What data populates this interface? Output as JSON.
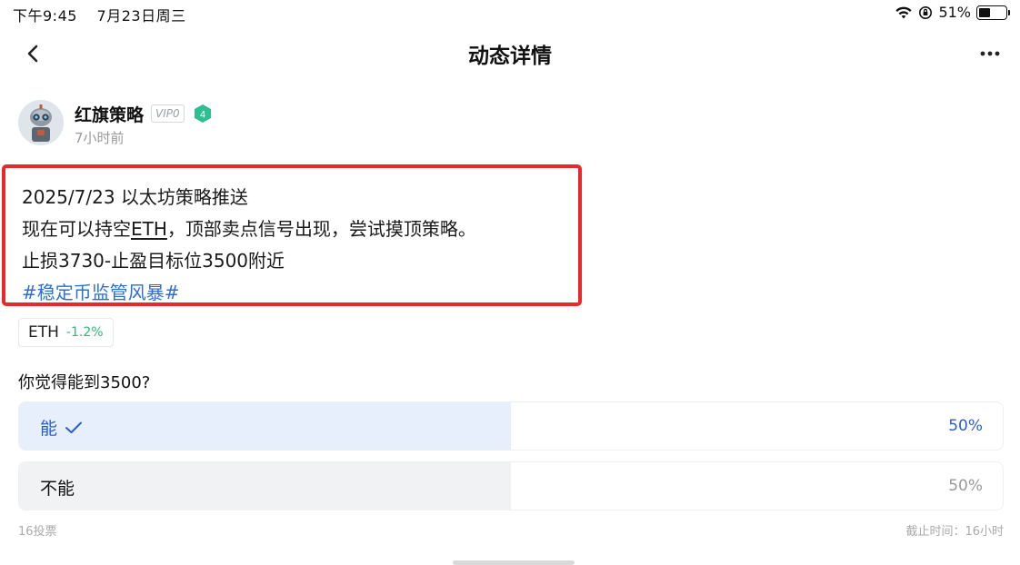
{
  "status_bar": {
    "time": "下午9:45",
    "date": "7月23日周三",
    "battery": "51%",
    "battery_level": 0.51
  },
  "nav": {
    "title": "动态详情",
    "back_icon": "chevron-left-icon",
    "more_icon": "more-horizontal-icon"
  },
  "author": {
    "name": "红旗策略",
    "vip": "VIP0",
    "level": "4",
    "time_ago": "7小时前"
  },
  "post": {
    "line1": "2025/7/23 以太坊策略推送",
    "line2_pre": "现在可以持空",
    "line2_eth": "ETH",
    "line2_post": "，顶部卖点信号出现，尝试摸顶策略。",
    "line3": "止损3730-止盈目标位3500附近",
    "hashtag": "#稳定币监管风暴#",
    "highlight_color": "#e8282b"
  },
  "coin": {
    "symbol": "ETH",
    "change": "-1.2%",
    "change_color": "#2eb87a"
  },
  "poll": {
    "question": "你觉得能到3500?",
    "options": [
      {
        "label": "能",
        "percent": "50%",
        "share": 0.5,
        "selected": true
      },
      {
        "label": "不能",
        "percent": "50%",
        "share": 0.5,
        "selected": false
      }
    ],
    "votes": "16投票",
    "deadline": "截止时间：16小时"
  },
  "colors": {
    "accent": "#2a5fc9",
    "selected_fill": "#e7effd",
    "unselected_fill": "#f1f2f4"
  }
}
